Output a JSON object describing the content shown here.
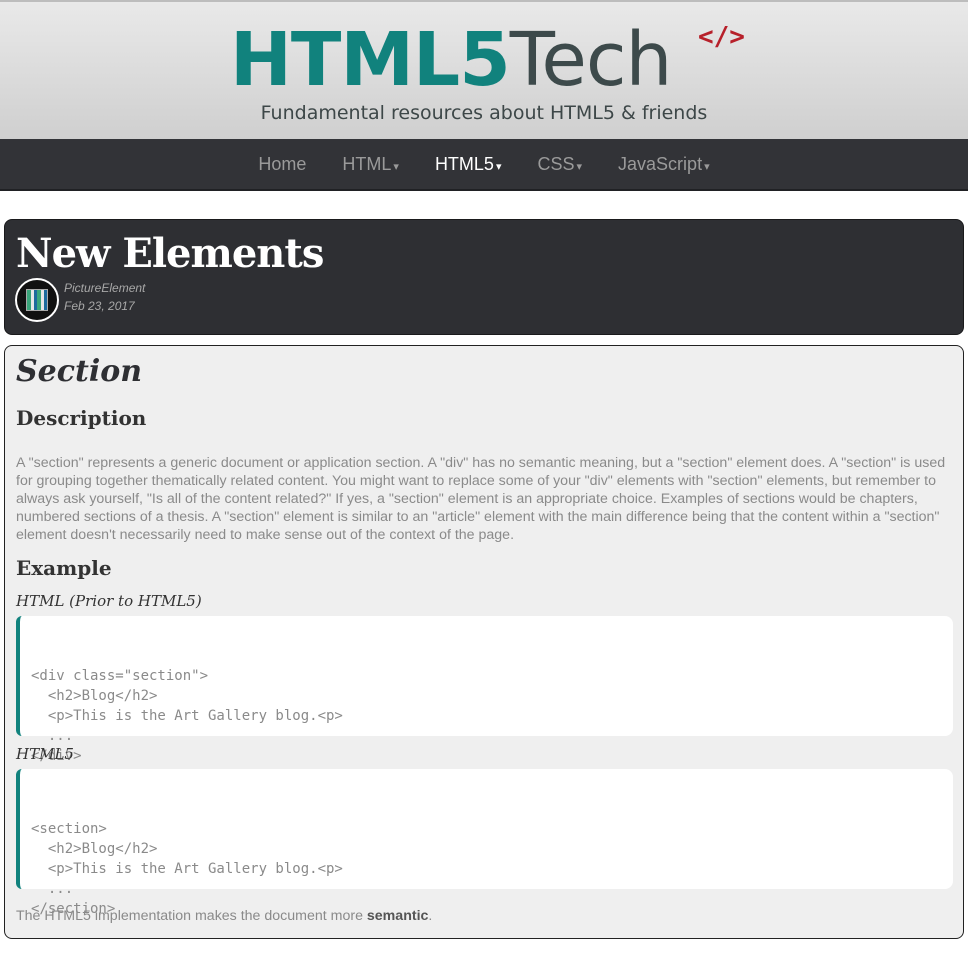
{
  "header": {
    "logo_html5": "HTML5",
    "logo_tech": "Tech",
    "logo_code": "</>",
    "tagline": "Fundamental resources about HTML5 & friends"
  },
  "nav": {
    "items": [
      {
        "label": "Home",
        "caret": ""
      },
      {
        "label": "HTML",
        "caret": "▾"
      },
      {
        "label": "HTML5",
        "caret": "▾"
      },
      {
        "label": "CSS",
        "caret": "▾"
      },
      {
        "label": "JavaScript",
        "caret": "▾"
      }
    ],
    "active": "HTML5"
  },
  "article": {
    "title": "New Elements",
    "author": "PictureElement",
    "date": "Feb 23, 2017"
  },
  "section": {
    "title": "Section",
    "description_heading": "Description",
    "description": "A \"section\" represents a generic document or application section. A \"div\" has no semantic meaning, but a \"section\" element does. A \"section\" is used for grouping together thematically related content. You might want to replace some of your \"div\" elements with \"section\" elements, but remember to always ask yourself, \"Is all of the content related?\" If yes, a \"section\" element is an appropriate choice. Examples of sections would be chapters, numbered sections of a thesis. A \"section\" element is similar to an \"article\" element with the main difference being that the content within a \"section\" element doesn't necessarily need to make sense out of the context of the page.",
    "example_heading": "Example",
    "example1_label": "HTML (Prior to HTML5)",
    "example1_lines": [
      "<div class=\"section\">",
      "  <h2>Blog</h2>",
      "  <p>This is the Art Gallery blog.<p>",
      "  ...",
      "</div>"
    ],
    "example2_label": "HTML5",
    "example2_lines": [
      "<section>",
      "  <h2>Blog</h2>",
      "  <p>This is the Art Gallery blog.<p>",
      "  ...",
      "</section>"
    ],
    "footer_prefix": "The HTML5 implementation makes the document more ",
    "footer_bold": "semantic",
    "footer_suffix": "."
  },
  "colors": {
    "brand_teal": "#11827d",
    "brand_red": "#b7202a",
    "nav_bg": "#323337"
  }
}
